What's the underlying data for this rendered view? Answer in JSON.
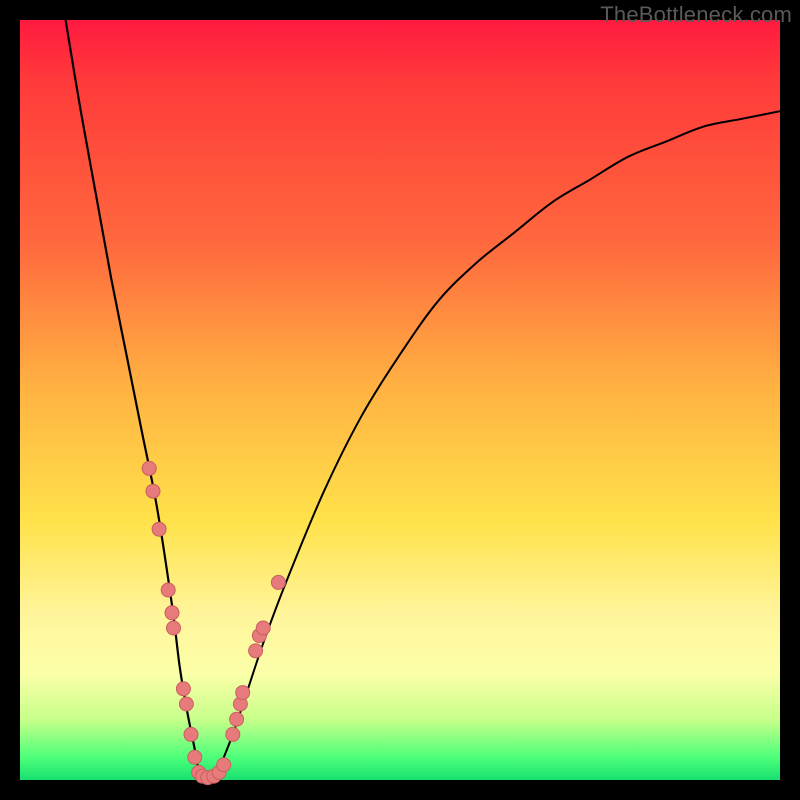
{
  "watermark": "TheBottleneck.com",
  "colors": {
    "curve": "#000000",
    "dots_fill": "#e77a7a",
    "dots_stroke": "#c95f5f",
    "background_top": "#ff1a40",
    "background_bottom": "#18e070",
    "frame": "#000000"
  },
  "chart_data": {
    "type": "line",
    "title": "",
    "xlabel": "",
    "ylabel": "",
    "xlim": [
      0,
      100
    ],
    "ylim": [
      0,
      100
    ],
    "note": "Axes are implied (no ticks/labels shown). Y expresses bottleneck mismatch percentage; lower (green) is better. Values are read from pixel positions against the 760×760 plot, rounded to whole percent.",
    "series": [
      {
        "name": "left-branch",
        "x": [
          6,
          8,
          10,
          12,
          14,
          16,
          18,
          20,
          21,
          22,
          23,
          23.5
        ],
        "y": [
          100,
          88,
          77,
          66,
          56,
          46,
          36,
          23,
          15,
          9,
          4,
          1
        ]
      },
      {
        "name": "right-branch",
        "x": [
          26,
          28,
          30,
          32,
          35,
          40,
          45,
          50,
          55,
          60,
          65,
          70,
          75,
          80,
          85,
          90,
          95,
          100
        ],
        "y": [
          1,
          6,
          12,
          18,
          26,
          38,
          48,
          56,
          63,
          68,
          72,
          76,
          79,
          82,
          84,
          86,
          87,
          88
        ]
      }
    ],
    "dots": [
      {
        "x": 17.0,
        "y": 41
      },
      {
        "x": 17.5,
        "y": 38
      },
      {
        "x": 18.3,
        "y": 33
      },
      {
        "x": 19.5,
        "y": 25
      },
      {
        "x": 20.0,
        "y": 22
      },
      {
        "x": 20.2,
        "y": 20
      },
      {
        "x": 21.5,
        "y": 12
      },
      {
        "x": 21.9,
        "y": 10
      },
      {
        "x": 22.5,
        "y": 6
      },
      {
        "x": 23.0,
        "y": 3
      },
      {
        "x": 23.5,
        "y": 1
      },
      {
        "x": 24.0,
        "y": 0.5
      },
      {
        "x": 24.7,
        "y": 0.3
      },
      {
        "x": 25.5,
        "y": 0.5
      },
      {
        "x": 26.2,
        "y": 1
      },
      {
        "x": 26.8,
        "y": 2
      },
      {
        "x": 28.0,
        "y": 6
      },
      {
        "x": 28.5,
        "y": 8
      },
      {
        "x": 29.0,
        "y": 10
      },
      {
        "x": 29.3,
        "y": 11.5
      },
      {
        "x": 31.0,
        "y": 17
      },
      {
        "x": 31.5,
        "y": 19
      },
      {
        "x": 32.0,
        "y": 20
      },
      {
        "x": 34.0,
        "y": 26
      }
    ]
  }
}
